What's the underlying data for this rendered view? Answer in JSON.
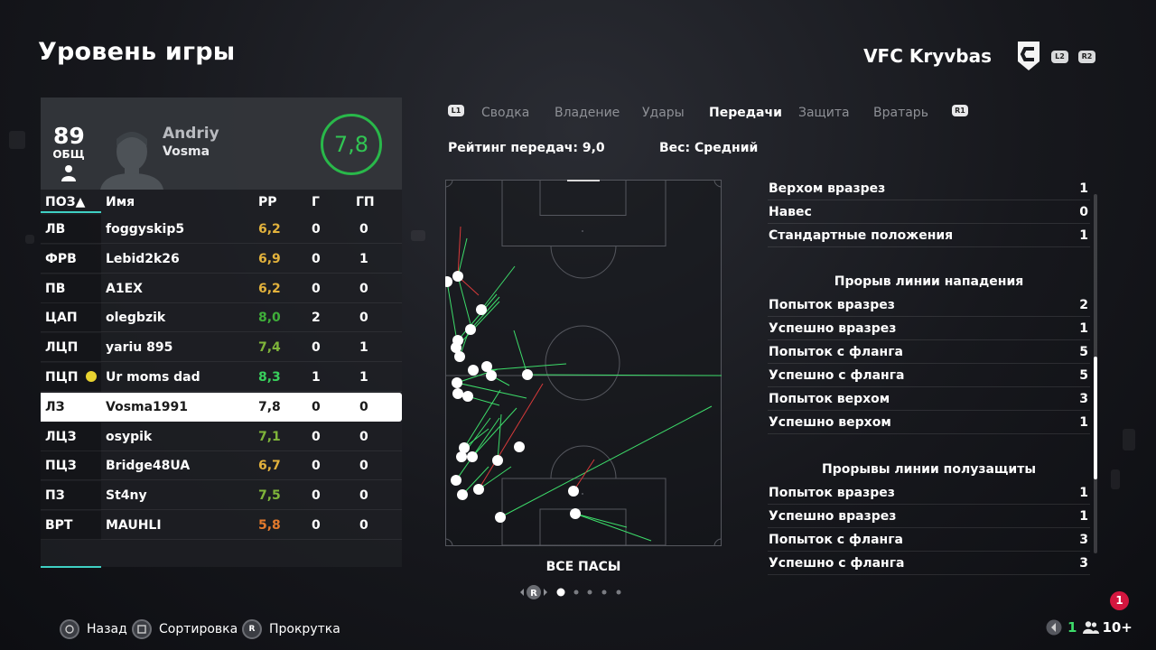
{
  "page_title": "Уровень игры",
  "club": {
    "name": "VFC Kryvbas",
    "logo_icon": "club-crest-icon",
    "btn_l2": "L2",
    "btn_r2": "R2"
  },
  "player": {
    "overall": "89",
    "overall_label": "ОБЩ",
    "first_name": "Andriy",
    "last_name": "Vosma",
    "rating": "7,8"
  },
  "table": {
    "headers": {
      "pos": "ПОЗ▲",
      "name": "Имя",
      "rating": "РР",
      "goals": "Г",
      "assists": "ГП"
    },
    "rows": [
      {
        "pos": "ЛВ",
        "name": "foggyskip5",
        "rating": "6,2",
        "goals": "0",
        "assists": "0",
        "rating_color": "#e3b23c"
      },
      {
        "pos": "ФРВ",
        "name": "Lebid2k26",
        "rating": "6,9",
        "goals": "0",
        "assists": "1",
        "rating_color": "#e3b23c"
      },
      {
        "pos": "ПВ",
        "name": "A1EX",
        "rating": "6,2",
        "goals": "0",
        "assists": "0",
        "rating_color": "#e3b23c"
      },
      {
        "pos": "ЦАП",
        "name": "olegbzik",
        "rating": "8,0",
        "goals": "2",
        "assists": "0",
        "rating_color": "#3fae3a"
      },
      {
        "pos": "ЛЦП",
        "name": "yariu 895",
        "rating": "7,4",
        "goals": "0",
        "assists": "1",
        "rating_color": "#7fb53a"
      },
      {
        "pos": "ПЦП",
        "name": "Ur moms dad",
        "rating": "8,3",
        "goals": "1",
        "assists": "1",
        "rating_color": "#39d05c",
        "motm": true
      },
      {
        "pos": "ЛЗ",
        "name": "Vosma1991",
        "rating": "7,8",
        "goals": "0",
        "assists": "0",
        "rating_color": "#1a1a1a",
        "selected": true
      },
      {
        "pos": "ЛЦЗ",
        "name": "osypik",
        "rating": "7,1",
        "goals": "0",
        "assists": "0",
        "rating_color": "#7fb53a"
      },
      {
        "pos": "ПЦЗ",
        "name": "Bridge48UA",
        "rating": "6,7",
        "goals": "0",
        "assists": "0",
        "rating_color": "#e3b23c"
      },
      {
        "pos": "ПЗ",
        "name": "St4ny",
        "rating": "7,5",
        "goals": "0",
        "assists": "0",
        "rating_color": "#7fb53a"
      },
      {
        "pos": "ВРТ",
        "name": "MAUHLI",
        "rating": "5,8",
        "goals": "0",
        "assists": "0",
        "rating_color": "#e37a2c"
      }
    ]
  },
  "tabs": {
    "l1": "L1",
    "r1": "R1",
    "items": [
      "Сводка",
      "Владение",
      "Удары",
      "Передачи",
      "Защита",
      "Вратарь"
    ],
    "active_index": 3
  },
  "pass_rating": "Рейтинг передач: 9,0",
  "weight": "Вес: Средний",
  "pitch_caption": "ВСЕ ПАСЫ",
  "pager_key": "R",
  "stats": {
    "top": [
      {
        "label": "Верхом вразрез",
        "value": "1"
      },
      {
        "label": "Навес",
        "value": "0"
      },
      {
        "label": "Стандартные положения",
        "value": "1"
      }
    ],
    "section1_title": "Прорыв линии нападения",
    "section1": [
      {
        "label": "Попыток вразрез",
        "value": "2"
      },
      {
        "label": "Успешно вразрез",
        "value": "1"
      },
      {
        "label": "Попыток с фланга",
        "value": "5"
      },
      {
        "label": "Успешно с фланга",
        "value": "5"
      },
      {
        "label": "Попыток верхом",
        "value": "3"
      },
      {
        "label": "Успешно верхом",
        "value": "1"
      }
    ],
    "section2_title": "Прорывы линии полузащиты",
    "section2": [
      {
        "label": "Попыток вразрез",
        "value": "1"
      },
      {
        "label": "Успешно вразрез",
        "value": "1"
      },
      {
        "label": "Попыток с фланга",
        "value": "3"
      },
      {
        "label": "Успешно с фланга",
        "value": "3"
      }
    ]
  },
  "footer": {
    "back": "Назад",
    "sort": "Сортировка",
    "scroll": "Прокрутка",
    "scroll_key": "R",
    "count": "1",
    "players": "10+",
    "notification": "1"
  },
  "colors": {
    "accent": "#3fd0c3",
    "rating_ring": "#29b84a",
    "pass_success": "#3ddc6a",
    "pass_fail": "#d83a3a",
    "notification": "#d4163f"
  }
}
